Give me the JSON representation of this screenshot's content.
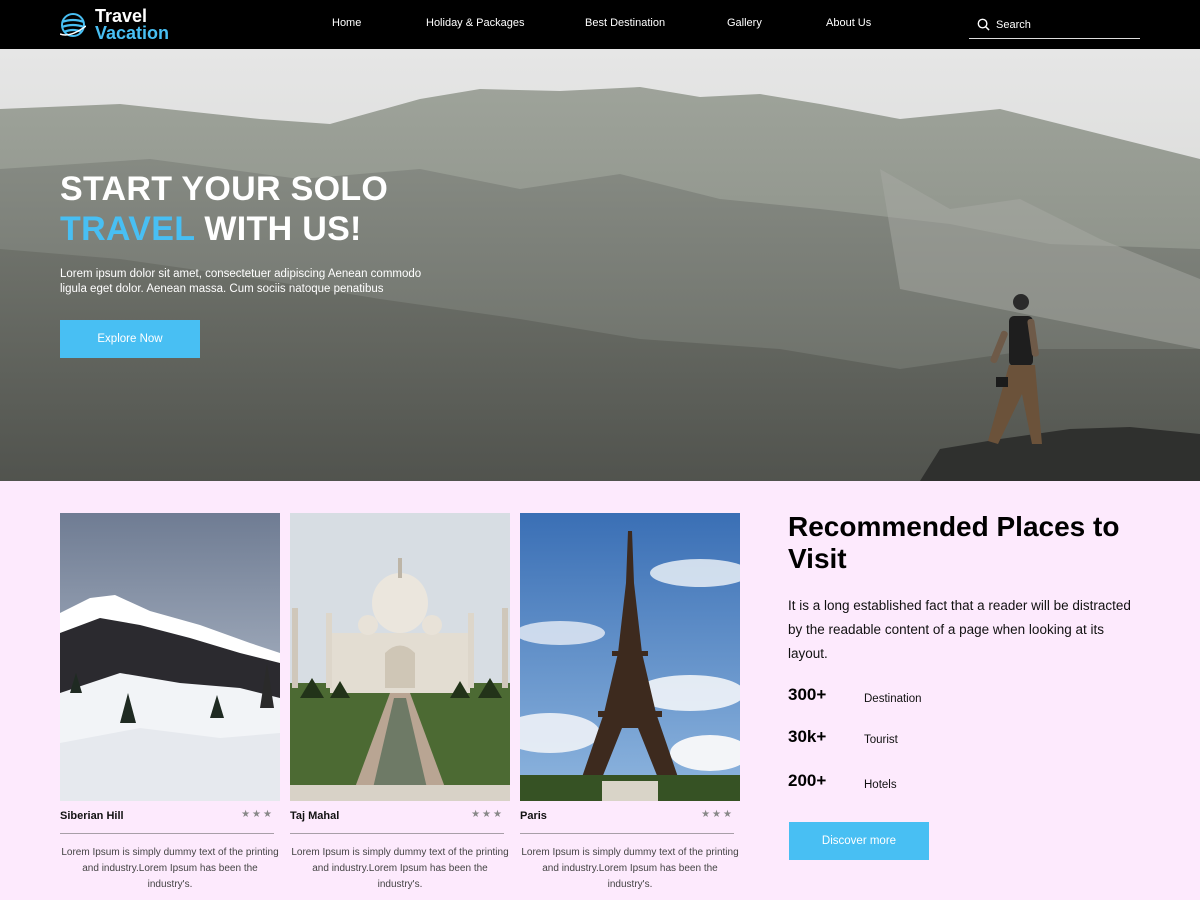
{
  "brand": {
    "line1": "Travel",
    "line2": "Vacation"
  },
  "nav": {
    "links": [
      "Home",
      "Holiday & Packages",
      "Best Destination",
      "Gallery",
      "About Us"
    ],
    "search_placeholder": "Search"
  },
  "hero": {
    "title_line1": "START YOUR SOLO",
    "title_accent": "TRAVEL",
    "title_rest": " WITH US!",
    "description": "Lorem ipsum dolor sit amet, consectetuer adipiscing Aenean commodo ligula eget dolor. Aenean massa. Cum sociis natoque penatibus",
    "button": "Explore Now"
  },
  "cards": [
    {
      "name": "Siberian Hill",
      "stars": "★★★",
      "text": "Lorem Ipsum is simply dummy text of the printing and industry.Lorem Ipsum has been the industry's."
    },
    {
      "name": "Taj Mahal",
      "stars": "★★★",
      "text": "Lorem Ipsum is simply dummy text of the printing and industry.Lorem Ipsum has been the industry's."
    },
    {
      "name": "Paris",
      "stars": "★★★",
      "text": "Lorem Ipsum is simply dummy text of the printing and industry.Lorem Ipsum has been the industry's."
    }
  ],
  "recommended": {
    "title": "Recommended Places to Visit",
    "description": "It is a long established fact that a reader will be distracted by the readable content of a page when looking at its layout.",
    "stats": [
      {
        "value": "300+",
        "label": "Destination"
      },
      {
        "value": "30k+",
        "label": "Tourist"
      },
      {
        "value": "200+",
        "label": "Hotels"
      }
    ],
    "button": "Discover more"
  },
  "colors": {
    "accent": "#48bff3",
    "nav_bg": "#000000",
    "section_bg": "#fdeafd"
  }
}
